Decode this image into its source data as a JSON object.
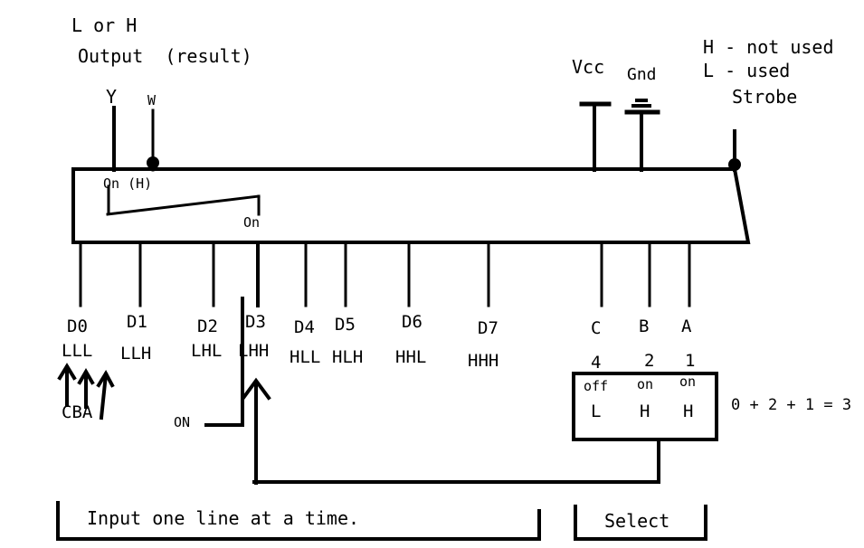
{
  "diagram": {
    "title_notes": {
      "output_level": "L or H",
      "output_label": "Output  (result)",
      "legend_high": "H - not used",
      "legend_low": "L - used",
      "strobe_label": "Strobe",
      "vcc_label": "Vcc",
      "gnd_label": "Gnd"
    },
    "output_pins": [
      {
        "name": "Y"
      },
      {
        "name": "W"
      }
    ],
    "chip_internal": {
      "on_high_label": "On (H)",
      "on_label": "On"
    },
    "data_pins": [
      {
        "name": "D0",
        "code": "LLL"
      },
      {
        "name": "D1",
        "code": "LLH"
      },
      {
        "name": "D2",
        "code": "LHL"
      },
      {
        "name": "D3",
        "code": "LHH"
      },
      {
        "name": "D4",
        "code": "HLL"
      },
      {
        "name": "D5",
        "code": "HLH"
      },
      {
        "name": "D6",
        "code": "HHL"
      },
      {
        "name": "D7",
        "code": "HHH"
      }
    ],
    "select_pins": [
      {
        "name": "C",
        "weight": "4",
        "state": "off",
        "level": "L"
      },
      {
        "name": "B",
        "weight": "2",
        "state": "on",
        "level": "H"
      },
      {
        "name": "A",
        "weight": "1",
        "state": "on",
        "level": "H"
      }
    ],
    "select_sum": "0 + 2 + 1 = 3",
    "input_arrows_label": "CBA",
    "on_marker_label": "ON",
    "brackets": [
      {
        "text": "Input one line at a time."
      },
      {
        "text": "Select"
      }
    ],
    "colors": {
      "ink": "#000000",
      "background": "#ffffff"
    }
  }
}
